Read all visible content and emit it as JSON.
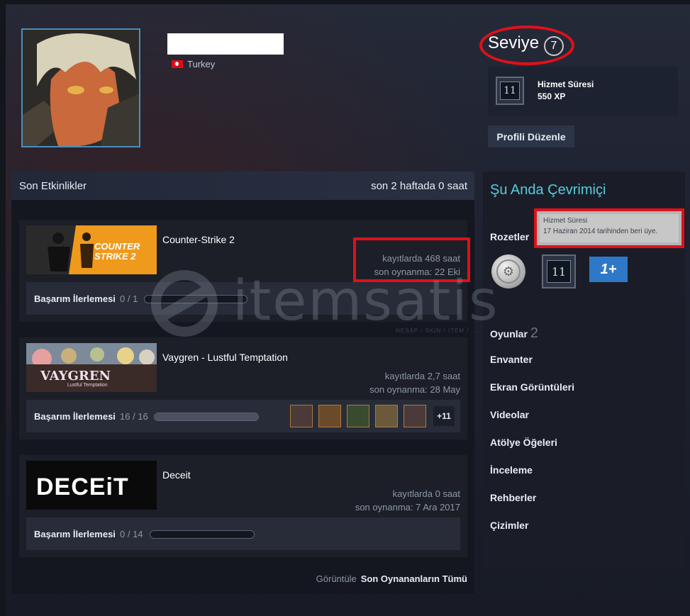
{
  "profile": {
    "country": "Turkey",
    "level_label": "Seviye",
    "level": "7",
    "featured_badge": {
      "title": "Hizmet Süresi",
      "xp": "550 XP",
      "icon_text": "11"
    },
    "edit_button": "Profili Düzenle"
  },
  "activity": {
    "title": "Son Etkinlikler",
    "hours_summary": "son 2 haftada 0 saat",
    "ach_label": "Başarım İlerlemesi",
    "games": [
      {
        "name": "Counter-Strike 2",
        "hours": "kayıtlarda 468 saat",
        "last_played": "son oynanma: 22 Eki",
        "ach_count": "0 / 1",
        "ach_progress": 0,
        "capsule_text_1": "COUNTER",
        "capsule_text_2": "STRIKE 2"
      },
      {
        "name": "Vaygren - Lustful Temptation",
        "hours": "kayıtlarda 2,7 saat",
        "last_played": "son oynanma: 28 May",
        "ach_count": "16 / 16",
        "ach_progress": 1,
        "capsule_text_1": "VAYGREN",
        "capsule_text_2": "Lustful Temptation",
        "more_achievements": "+11"
      },
      {
        "name": "Deceit",
        "hours": "kayıtlarda 0 saat",
        "last_played": "son oynanma: 7 Ara 2017",
        "ach_count": "0 / 14",
        "ach_progress": 0,
        "capsule_text_1": "DECEiT"
      }
    ],
    "footer_prefix": "Görüntüle",
    "footer_link": "Son Oynananların Tümü"
  },
  "sidebar": {
    "status": "Şu Anda Çevrimiçi",
    "badges_label": "Rozetler",
    "tooltip_title": "Hizmet Süresi",
    "tooltip_text": "17 Haziran 2014 tarihinden beri üye.",
    "badge_icons": [
      "silver-coin-icon",
      "years-of-service-icon",
      "one-plus-icon"
    ],
    "badge2_text": "11",
    "badge3_text": "1+",
    "games_label": "Oyunlar",
    "games_count": "2",
    "links": [
      "Envanter",
      "Ekran Görüntüleri",
      "Videolar",
      "Atölye Öğeleri",
      "İnceleme",
      "Rehberler",
      "Çizimler"
    ]
  },
  "watermark": {
    "text": "itemsatis",
    "sub": "HESAP / SKIN / ITEM / ..."
  },
  "colors": {
    "accent_online": "#57cbde",
    "highlight": "#e0101a",
    "badge_blue": "#2e78c8"
  }
}
